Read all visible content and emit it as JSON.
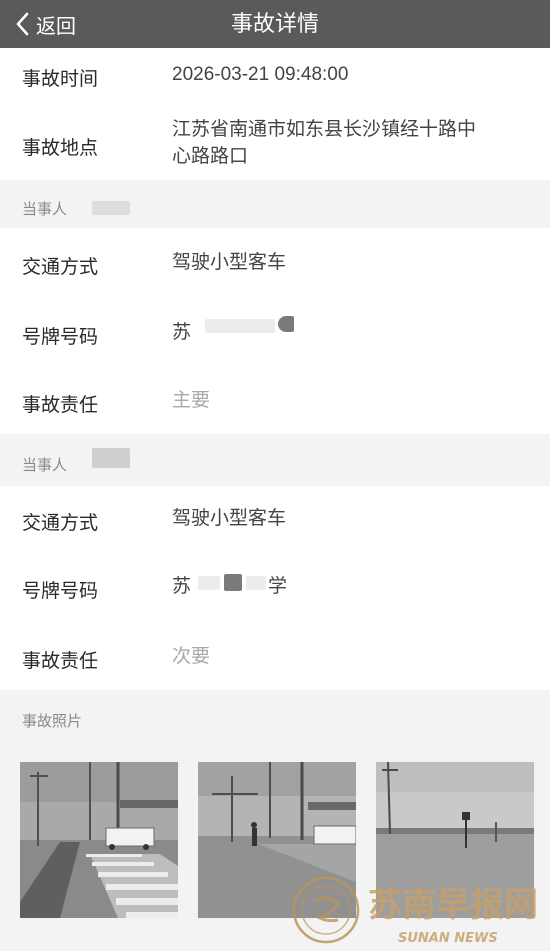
{
  "nav": {
    "back_label": "返回",
    "title": "事故详情"
  },
  "info": {
    "time_label": "事故时间",
    "time_value": "2026-03-21 09:48:00",
    "place_label": "事故地点",
    "place_value_line1": "江苏省南通市如东县长沙镇经十路中",
    "place_value_line2": "心路路口"
  },
  "parties": [
    {
      "header": "当事人",
      "mode_label": "交通方式",
      "mode_value": "驾驶小型客车",
      "plate_label": "号牌号码",
      "plate_prefix": "苏",
      "plate_suffix": "",
      "resp_label": "事故责任",
      "resp_value": "主要"
    },
    {
      "header": "当事人",
      "mode_label": "交通方式",
      "mode_value": "驾驶小型客车",
      "plate_label": "号牌号码",
      "plate_prefix": "苏",
      "plate_suffix": "学",
      "resp_label": "事故责任",
      "resp_value": "次要"
    }
  ],
  "photos": {
    "header": "事故照片"
  },
  "watermark": {
    "name": "苏南早报网",
    "sub": "SUNAN NEWS"
  }
}
